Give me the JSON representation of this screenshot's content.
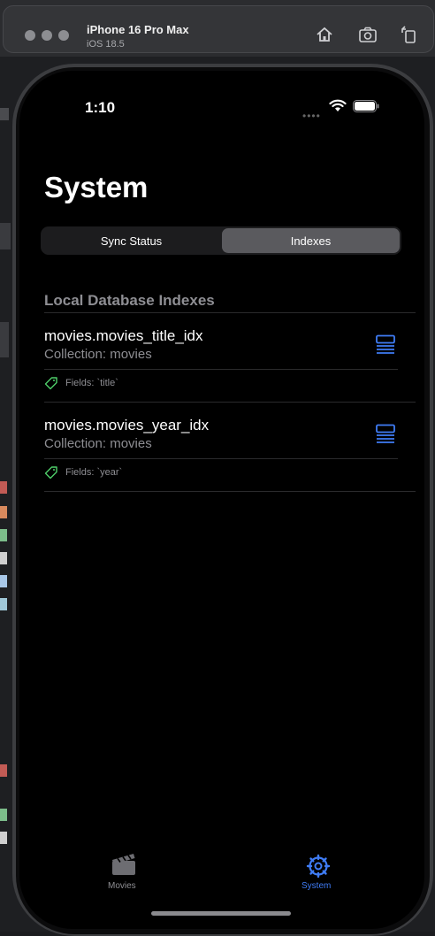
{
  "simulator": {
    "device_name": "iPhone 16 Pro Max",
    "os_version": "iOS 18.5"
  },
  "status_bar": {
    "time": "1:10"
  },
  "page": {
    "title": "System"
  },
  "segmented_control": {
    "segments": [
      {
        "label": "Sync Status",
        "selected": false
      },
      {
        "label": "Indexes",
        "selected": true
      }
    ]
  },
  "section": {
    "header": "Local Database Indexes"
  },
  "indexes": [
    {
      "name": "movies.movies_title_idx",
      "collection": "Collection: movies",
      "fields": "Fields: `title`"
    },
    {
      "name": "movies.movies_year_idx",
      "collection": "Collection: movies",
      "fields": "Fields: `year`"
    }
  ],
  "tab_bar": {
    "tabs": [
      {
        "label": "Movies",
        "icon": "clapperboard-icon",
        "selected": false
      },
      {
        "label": "System",
        "icon": "gear-icon",
        "selected": true
      }
    ]
  },
  "colors": {
    "accent": "#3f7cf5",
    "tag_green": "#4fd06b",
    "secondary_text": "#8e8e93",
    "background": "#000000"
  }
}
